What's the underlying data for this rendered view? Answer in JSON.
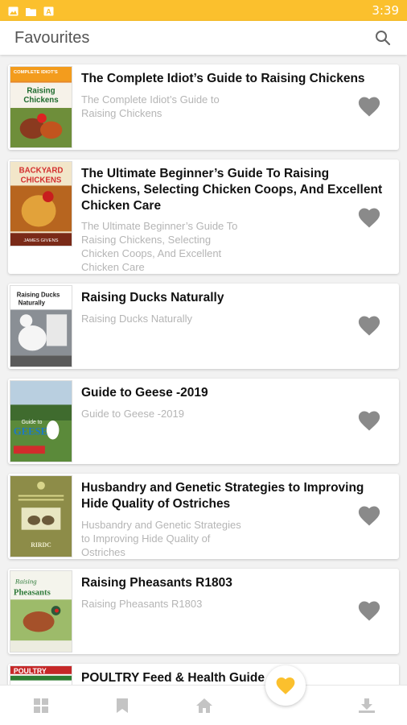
{
  "status_bar": {
    "time": "3:39",
    "color": "#fbc02d"
  },
  "app_bar": {
    "title": "Favourites",
    "search_icon": "search-icon"
  },
  "favourites": [
    {
      "title": "The Complete Idiot’s Guide to Raising Chickens",
      "subtitle": "The Complete Idiot’s Guide to Raising Chickens",
      "cover_text": [
        "COMPLETE IDIOT'S",
        "Raising",
        "Chickens"
      ]
    },
    {
      "title": "The Ultimate Beginner’s Guide To Raising Chickens, Selecting Chicken Coops, And Excellent Chicken Care",
      "subtitle": "The Ultimate Beginner’s Guide To Raising Chickens, Selecting Chicken Coops, And Excellent Chicken Care",
      "cover_text": [
        "BACKYARD",
        "CHICKENS",
        "JAMES GIVENS"
      ]
    },
    {
      "title": "Raising Ducks Naturally",
      "subtitle": "Raising Ducks Naturally",
      "cover_text": [
        "Raising Ducks",
        "Naturally"
      ]
    },
    {
      "title": "Guide to Geese -2019",
      "subtitle": "Guide to Geese -2019",
      "cover_text": [
        "Guide to",
        "GEESE"
      ]
    },
    {
      "title": "Husbandry and Genetic Strategies to Improving Hide Quality of Ostriches",
      "subtitle": "Husbandry and Genetic Strategies to Improving Hide Quality of Ostriches",
      "cover_text": [
        "RIRDC"
      ]
    },
    {
      "title": "Raising Pheasants R1803",
      "subtitle": "Raising Pheasants R1803",
      "cover_text": [
        "Raising",
        "Pheasants"
      ]
    },
    {
      "title": "POULTRY Feed & Health Guide",
      "subtitle": "",
      "cover_text": [
        "POULTRY"
      ]
    }
  ],
  "bottom_nav": {
    "items": [
      "grid-icon",
      "bookmark-icon",
      "home-icon",
      "heart-icon",
      "download-icon"
    ],
    "active": "heart-icon",
    "active_color": "#fbc02d",
    "inactive_color": "#c4c4c4"
  }
}
